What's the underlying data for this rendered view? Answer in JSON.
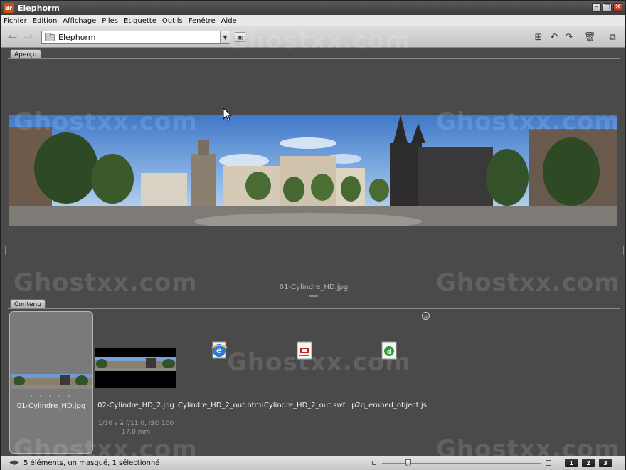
{
  "window": {
    "title": "Elephorm",
    "app_logo": "Br"
  },
  "menu": [
    "Fichier",
    "Edition",
    "Affichage",
    "Piles",
    "Etiquette",
    "Outils",
    "Fenêtre",
    "Aide"
  ],
  "toolbar": {
    "path": "Elephorm"
  },
  "preview_panel": {
    "tab": "Aperçu",
    "caption": "01-Cylindre_HD.jpg"
  },
  "content_panel": {
    "tab": "Contenu",
    "items": [
      {
        "name": "01-Cylindre_HD.jpg",
        "selected": true
      },
      {
        "name": "02-Cylindre_HD_2.jpg",
        "meta1": "1/30 s à f/11,0, ISO 100",
        "meta2": "17,0 mm"
      },
      {
        "name": "Cylindre_HD_2_out.html",
        "icon": "ie-html-icon"
      },
      {
        "name": "Cylindre_HD_2_out.swf",
        "icon": "swf-file-icon"
      },
      {
        "name": "p2q_embed_object.js",
        "icon": "js-file-icon"
      }
    ]
  },
  "status": {
    "text": "5 éléments, un masqué, 1 sélectionné",
    "view_buttons": [
      "1",
      "2",
      "3"
    ]
  },
  "watermark": "Ghostxx.com",
  "colors": {
    "app_bg": "#4a4a4a",
    "selection": "#7a7a7a",
    "logo": "#c8501a"
  }
}
